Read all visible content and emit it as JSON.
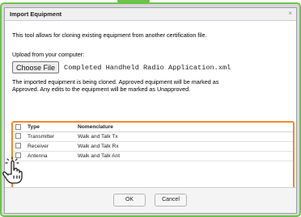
{
  "dialog": {
    "title": "Import Equipment",
    "close_glyph": "×",
    "intro": "This tool allows for cloning existing equipment from another certification file.",
    "upload_label": "Upload from your computer:",
    "choose_file_label": "Choose File",
    "file_name": "Completed Handheld Radio Application.xml",
    "note_line1": "The imported equipment is being cloned. Approved equipment will be marked as",
    "note_line2": "Approved. Any edits to the equipment will be marked as Unapproved."
  },
  "table": {
    "headers": [
      "Type",
      "Nomenclature"
    ],
    "rows": [
      {
        "type": "Transmitter",
        "nomenclature": "Walk and Talk Tx"
      },
      {
        "type": "Receiver",
        "nomenclature": "Walk and Talk Rx"
      },
      {
        "type": "Antenna",
        "nomenclature": "Walk and Talk Ant"
      }
    ]
  },
  "footer": {
    "ok_label": "OK",
    "cancel_label": "Cancel"
  },
  "colors": {
    "frame_green": "#6cc24a",
    "highlight_orange": "#f18a2b"
  },
  "icons": {
    "pointer": "hand-pointer-icon"
  }
}
